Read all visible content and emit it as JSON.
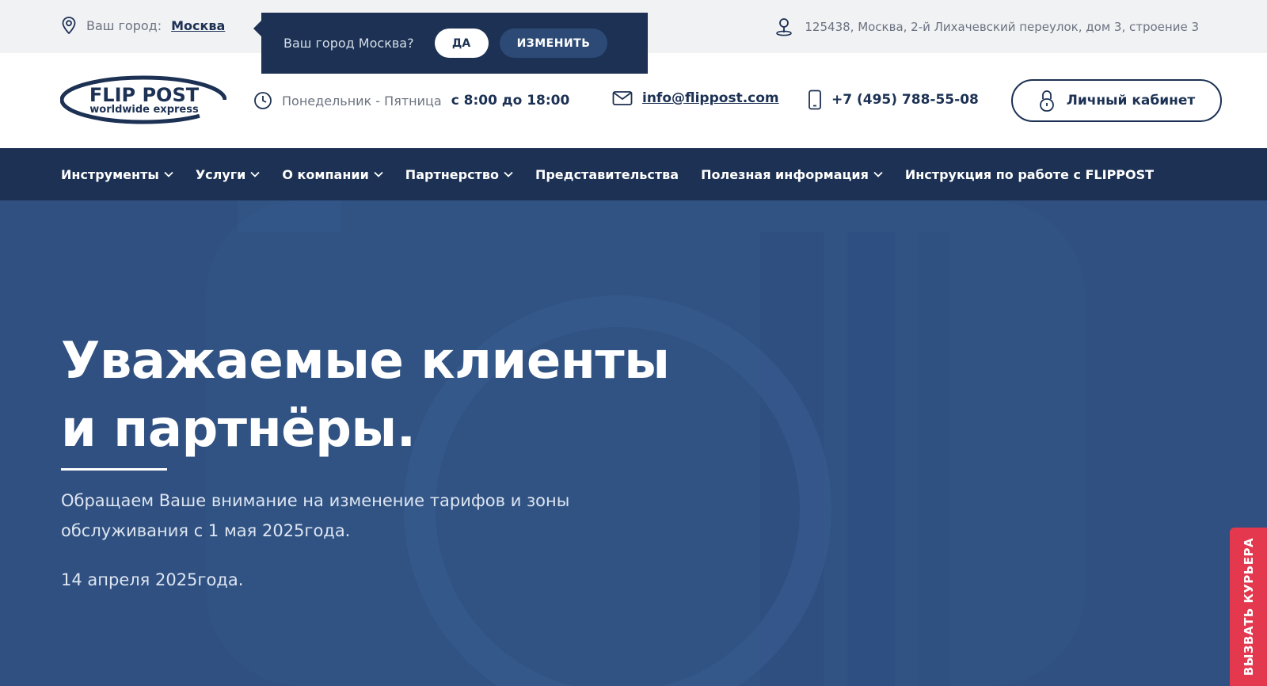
{
  "topbar": {
    "city_label": "Ваш город:",
    "city_value": "Москва",
    "address": "125438, Москва, 2-й Лихачевский переулок, дом 3, строение 3"
  },
  "popup": {
    "question": "Ваш город Москва?",
    "yes_label": "ДА",
    "change_label": "ИЗМЕНИТЬ"
  },
  "header": {
    "logo_top": "FLIP POST",
    "logo_bottom": "worldwide express",
    "hours_prefix": "Понедельник - Пятница",
    "hours_value": "с 8:00 до 18:00",
    "email": "info@flippost.com",
    "phone": "+7 (495) 788-55-08",
    "cabinet_label": "Личный кабинет"
  },
  "nav": {
    "items": [
      {
        "label": "Инструменты",
        "dropdown": true
      },
      {
        "label": "Услуги",
        "dropdown": true
      },
      {
        "label": "О компании",
        "dropdown": true
      },
      {
        "label": "Партнерство",
        "dropdown": true
      },
      {
        "label": "Представительства",
        "dropdown": false
      },
      {
        "label": "Полезная информация",
        "dropdown": true
      },
      {
        "label": "Инструкция по работе с FLIPPOST",
        "dropdown": false
      }
    ]
  },
  "hero": {
    "title_line1": "Уважаемые клиенты",
    "title_line2": "и партнёры.",
    "text": "Обращаем Ваше внимание на изменение тарифов и зоны обслуживания с 1 мая 2025года.",
    "date": "14 апреля 2025года."
  },
  "courier": {
    "label": "ВЫЗВАТЬ КУРЬЕРА"
  },
  "colors": {
    "navy": "#1c3153",
    "hero": "#2f5080",
    "accent_red": "#e4384f"
  }
}
